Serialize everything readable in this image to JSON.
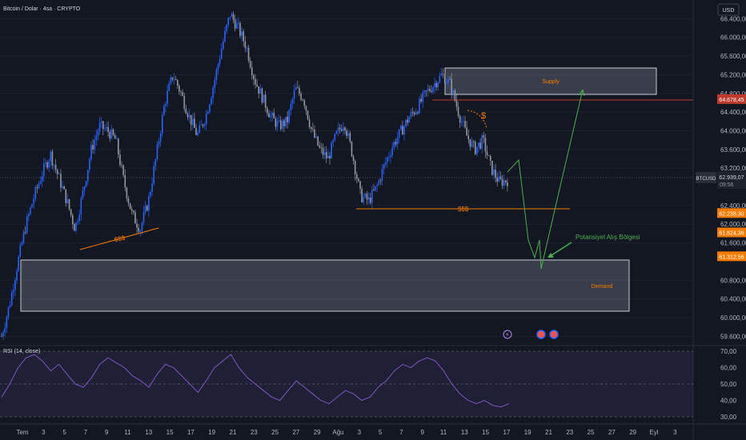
{
  "header": {
    "symbol_title": "Bitcoin / Dolar · 4sa · CRYPTO",
    "currency": "USD"
  },
  "price_axis": {
    "ticks": [
      "66.400,00",
      "66.000,00",
      "65.600,00",
      "65.200,00",
      "64.800,00",
      "64.400,00",
      "64.000,00",
      "63.600,00",
      "63.200,00",
      "62.400,00",
      "62.000,00",
      "61.600,00",
      "60.800,00",
      "60.400,00",
      "60.000,00",
      "59.600,00"
    ],
    "symbol_badge": "BTCUSD",
    "current_price": "62.939,07",
    "countdown": "09:56",
    "labels": [
      {
        "text": "64.678,45",
        "color": "#c0392b",
        "value": 64678.45
      },
      {
        "text": "62.238,30",
        "color": "#f57c00",
        "value": 62238.3
      },
      {
        "text": "61.824,36",
        "color": "#f57c00",
        "value": 61824.36
      },
      {
        "text": "61.312,56",
        "color": "#f57c00",
        "value": 61312.56
      }
    ]
  },
  "rsi_pane": {
    "title": "RSI (14, close)",
    "ticks": [
      "70,00",
      "60,00",
      "50,00",
      "40,00",
      "30,00"
    ],
    "band": [
      30,
      70
    ]
  },
  "time_axis": {
    "labels": [
      "Tem",
      "3",
      "5",
      "7",
      "9",
      "11",
      "13",
      "15",
      "17",
      "19",
      "21",
      "23",
      "25",
      "27",
      "29",
      "Ağu",
      "3",
      "5",
      "7",
      "9",
      "11",
      "13",
      "15",
      "17",
      "19",
      "21",
      "23",
      "25",
      "27",
      "29",
      "Eyl",
      "3"
    ]
  },
  "annotations": {
    "supply_label": "Supply",
    "demand_label": "Demand",
    "liquidity_left": "$$$",
    "liquidity_mid": "$$$",
    "dollar_sign": "$",
    "potential_buy": "Potansiyel Alış Bölgesi"
  },
  "colors": {
    "background": "#131722",
    "bull": "#2962ff",
    "bear": "#9598a1",
    "supply_line": "#c0392b",
    "liquidity": "#f57c00",
    "projection": "#4caf50",
    "rsi_line": "#7e57c2",
    "rsi_band": "#7e57c2"
  },
  "chart_data": {
    "type": "candlestick",
    "title": "Bitcoin / Dolar · 4sa · CRYPTO",
    "ylim": [
      59400,
      66800
    ],
    "price_path_close": [
      59600,
      60300,
      61200,
      62000,
      62600,
      63100,
      63500,
      63000,
      62500,
      61900,
      62700,
      63600,
      64100,
      64000,
      63800,
      62900,
      62200,
      61900,
      62500,
      63500,
      64600,
      65200,
      64800,
      64300,
      63900,
      64300,
      65000,
      65800,
      66500,
      66200,
      65800,
      65100,
      64700,
      64300,
      64100,
      64200,
      64900,
      64700,
      64000,
      63600,
      63400,
      63900,
      64200,
      63500,
      62600,
      62500,
      62800,
      63300,
      63700,
      64000,
      64300,
      64500,
      64800,
      65000,
      65200,
      65000,
      64400,
      63900,
      63600,
      63800,
      63200,
      62900,
      62940
    ],
    "rsi_path": [
      42,
      50,
      60,
      66,
      68,
      64,
      58,
      62,
      56,
      50,
      48,
      54,
      62,
      66,
      63,
      60,
      55,
      52,
      48,
      56,
      62,
      60,
      55,
      50,
      45,
      52,
      60,
      64,
      68,
      60,
      54,
      50,
      46,
      42,
      40,
      46,
      52,
      48,
      44,
      40,
      38,
      42,
      46,
      44,
      40,
      42,
      48,
      52,
      58,
      62,
      60,
      64,
      66,
      64,
      58,
      50,
      44,
      40,
      38,
      40,
      37,
      36,
      38
    ],
    "zones": {
      "supply": [
        64800,
        65300
      ],
      "demand": [
        59990,
        61120
      ]
    },
    "levels": {
      "supply_line": 64678.45,
      "liquidity_mid": 62238.3
    }
  }
}
